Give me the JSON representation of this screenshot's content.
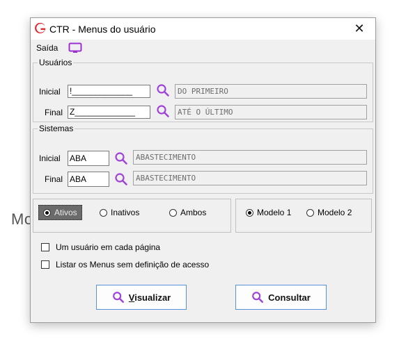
{
  "background": {
    "partial_text": "Mo"
  },
  "window": {
    "title": "CTR - Menus do usuário",
    "close_glyph": "✕",
    "logo_color": "#e2242a"
  },
  "menu": {
    "exit_label": "Saída"
  },
  "usuarios": {
    "legend": "Usuários",
    "inicial": {
      "label": "Inicial",
      "value": "!_____________",
      "description": "DO PRIMEIRO"
    },
    "final": {
      "label": "Final",
      "value": "Z_____________",
      "description": "ATÉ O ÚLTIMO"
    }
  },
  "sistemas": {
    "legend": "Sistemas",
    "inicial": {
      "label": "Inicial",
      "value": "ABA",
      "description": "ABASTECIMENTO"
    },
    "final": {
      "label": "Final",
      "value": "ABA",
      "description": "ABASTECIMENTO"
    }
  },
  "status_filter": {
    "options": [
      "Ativos",
      "Inativos",
      "Ambos"
    ],
    "selected": "Ativos"
  },
  "model_filter": {
    "options": [
      "Modelo 1",
      "Modelo 2"
    ],
    "selected": "Modelo 1"
  },
  "checkboxes": {
    "one_user_per_page": {
      "label": "Um usuário em cada página",
      "checked": false
    },
    "list_menus_without_access": {
      "label": "Listar os Menus sem definição de acesso",
      "checked": false
    }
  },
  "buttons": {
    "visualizar": {
      "label_first": "V",
      "label_rest": "isualizar"
    },
    "consultar": {
      "label": "Consultar"
    }
  },
  "colors": {
    "search_icon": "#a044d8",
    "monitor_icon": "#9b2fd0",
    "button_border": "#5b8fd6",
    "readonly_text": "#6d6d6d"
  }
}
